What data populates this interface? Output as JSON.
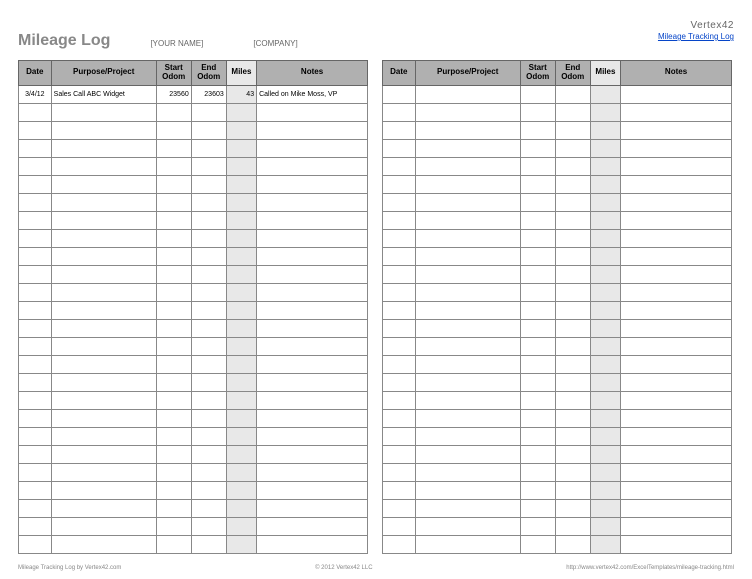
{
  "header": {
    "title": "Mileage Log",
    "name_placeholder": "[YOUR NAME]",
    "company_placeholder": "[COMPANY]",
    "brand": "Vertex42",
    "link_text": "Mileage Tracking Log"
  },
  "columns": {
    "date": "Date",
    "purpose": "Purpose/Project",
    "start": "Start Odom",
    "end": "End Odom",
    "miles": "Miles",
    "notes": "Notes"
  },
  "left_rows": [
    {
      "date": "3/4/12",
      "purpose": "Sales Call ABC Widget",
      "start": "23560",
      "end": "23603",
      "miles": "43",
      "notes": "Called on Mike Moss, VP"
    },
    {},
    {},
    {},
    {},
    {},
    {},
    {},
    {},
    {},
    {},
    {},
    {},
    {},
    {},
    {},
    {},
    {},
    {},
    {},
    {},
    {},
    {},
    {},
    {},
    {}
  ],
  "right_rows": [
    {},
    {},
    {},
    {},
    {},
    {},
    {},
    {},
    {},
    {},
    {},
    {},
    {},
    {},
    {},
    {},
    {},
    {},
    {},
    {},
    {},
    {},
    {},
    {},
    {},
    {}
  ],
  "footer": {
    "left": "Mileage Tracking Log by Vertex42.com",
    "center": "© 2012 Vertex42 LLC",
    "right": "http://www.vertex42.com/ExcelTemplates/mileage-tracking.html"
  }
}
